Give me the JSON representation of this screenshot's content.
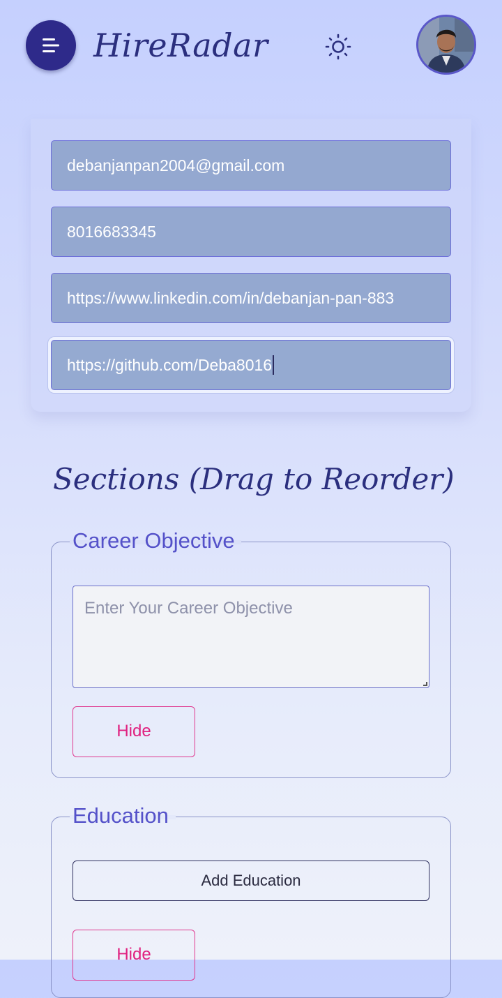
{
  "header": {
    "brand": "HireRadar",
    "menu_icon": "menu-icon",
    "theme_icon": "sun-icon",
    "avatar_icon": "user-avatar"
  },
  "contact": {
    "email": "debanjanpan2004@gmail.com",
    "phone": "8016683345",
    "linkedin": "https://www.linkedin.com/in/debanjan-pan-883",
    "github": "https://github.com/Deba8016"
  },
  "sections": {
    "title": "Sections (Drag to Reorder)",
    "objective": {
      "legend": "Career Objective",
      "placeholder": "Enter Your Career Objective",
      "hide_label": "Hide"
    },
    "education": {
      "legend": "Education",
      "add_label": "Add Education",
      "hide_label": "Hide"
    }
  },
  "colors": {
    "accent": "#2e2a8a",
    "field_bg": "#94a8d0",
    "hide": "#e0207f",
    "legend": "#5451c9"
  }
}
